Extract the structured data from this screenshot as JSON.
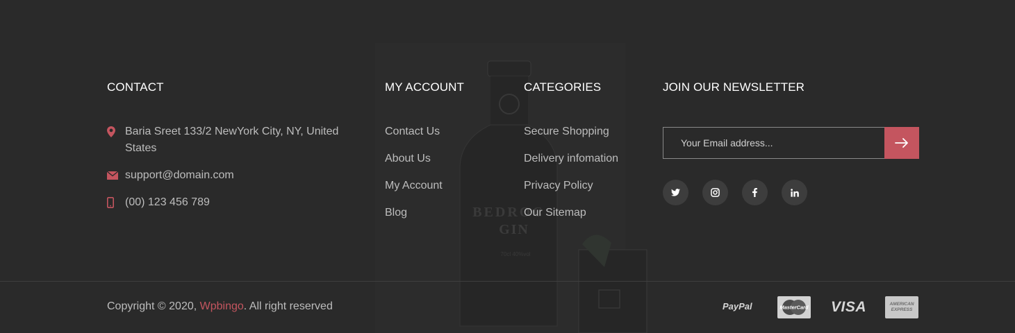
{
  "contact": {
    "title": "CONTACT",
    "address": "Baria Sreet 133/2 NewYork City, NY, United States",
    "email": "support@domain.com",
    "phone": "(00) 123 456 789"
  },
  "my_account": {
    "title": "MY ACCOUNT",
    "links": [
      "Contact Us",
      "About Us",
      "My Account",
      "Blog"
    ]
  },
  "categories": {
    "title": "CATEGORIES",
    "links": [
      "Secure Shopping",
      "Delivery infomation",
      "Privacy Policy",
      "Our Sitemap"
    ]
  },
  "newsletter": {
    "title": "JOIN OUR NEWSLETTER",
    "placeholder": "Your Email address...",
    "submit_icon": "arrow-right-icon",
    "social": [
      "twitter-icon",
      "instagram-icon",
      "facebook-icon",
      "linkedin-icon"
    ]
  },
  "background_art": {
    "bottle_label_line1": "BEDROC",
    "bottle_label_line2": "GIN",
    "bottle_small_text": "70cl   40%vol"
  },
  "footer": {
    "copyright_prefix": "Copyright © 2020, ",
    "brand": "Wpbingo",
    "copyright_suffix": ". All right reserved",
    "payments": [
      "PayPal",
      "MasterCard",
      "VISA",
      "AMERICAN EXPRESS"
    ]
  },
  "colors": {
    "background": "#2a2a2a",
    "accent": "#c4555f",
    "heading": "#ffffff",
    "text": "#bdbdbd"
  }
}
